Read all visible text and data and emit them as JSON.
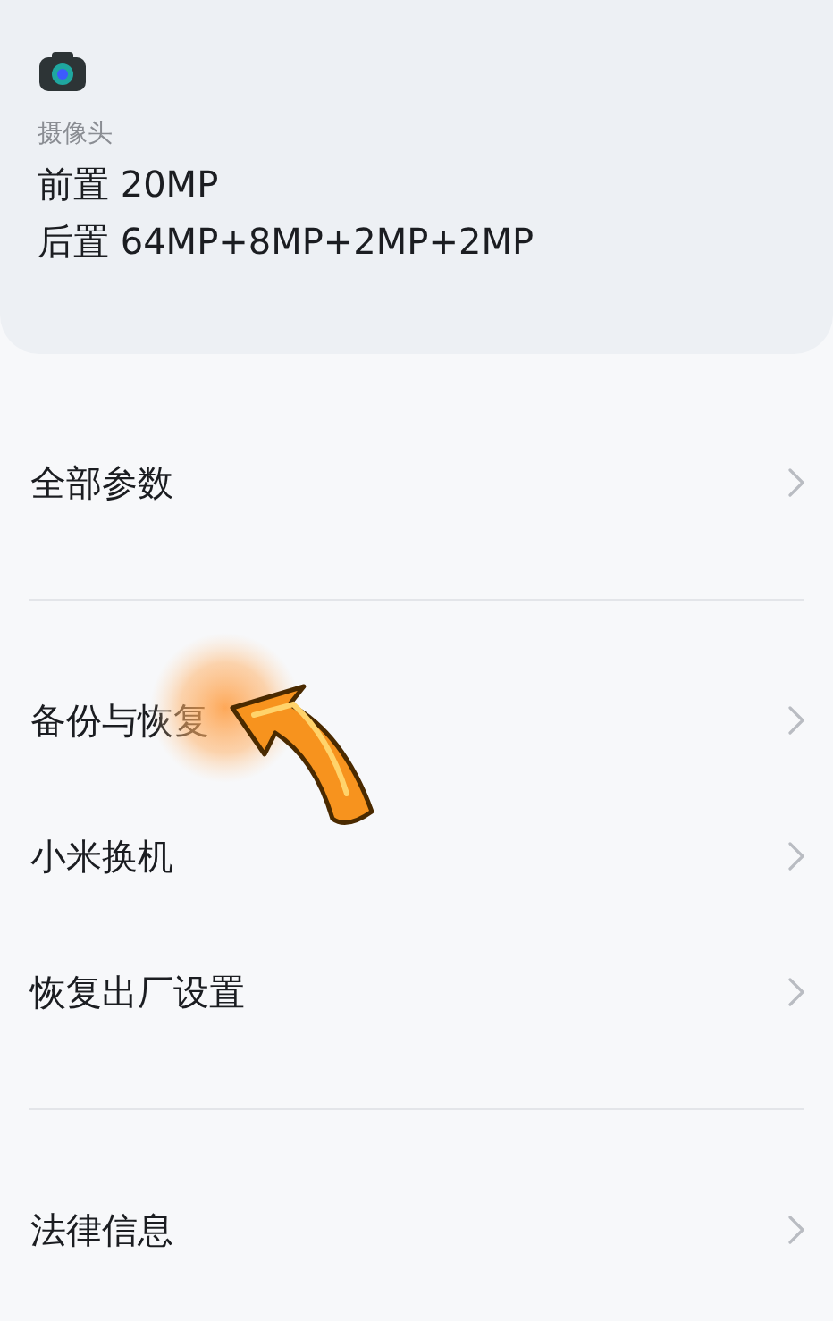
{
  "camera_card": {
    "label": "摄像头",
    "lines": [
      "前置 20MP",
      "后置 64MP+8MP+2MP+2MP"
    ]
  },
  "groups": [
    {
      "items": [
        {
          "label": "全部参数"
        }
      ]
    },
    {
      "items": [
        {
          "label": "备份与恢复"
        },
        {
          "label": "小米换机"
        },
        {
          "label": "恢复出厂设置"
        }
      ]
    },
    {
      "items": [
        {
          "label": "法律信息"
        }
      ]
    }
  ]
}
